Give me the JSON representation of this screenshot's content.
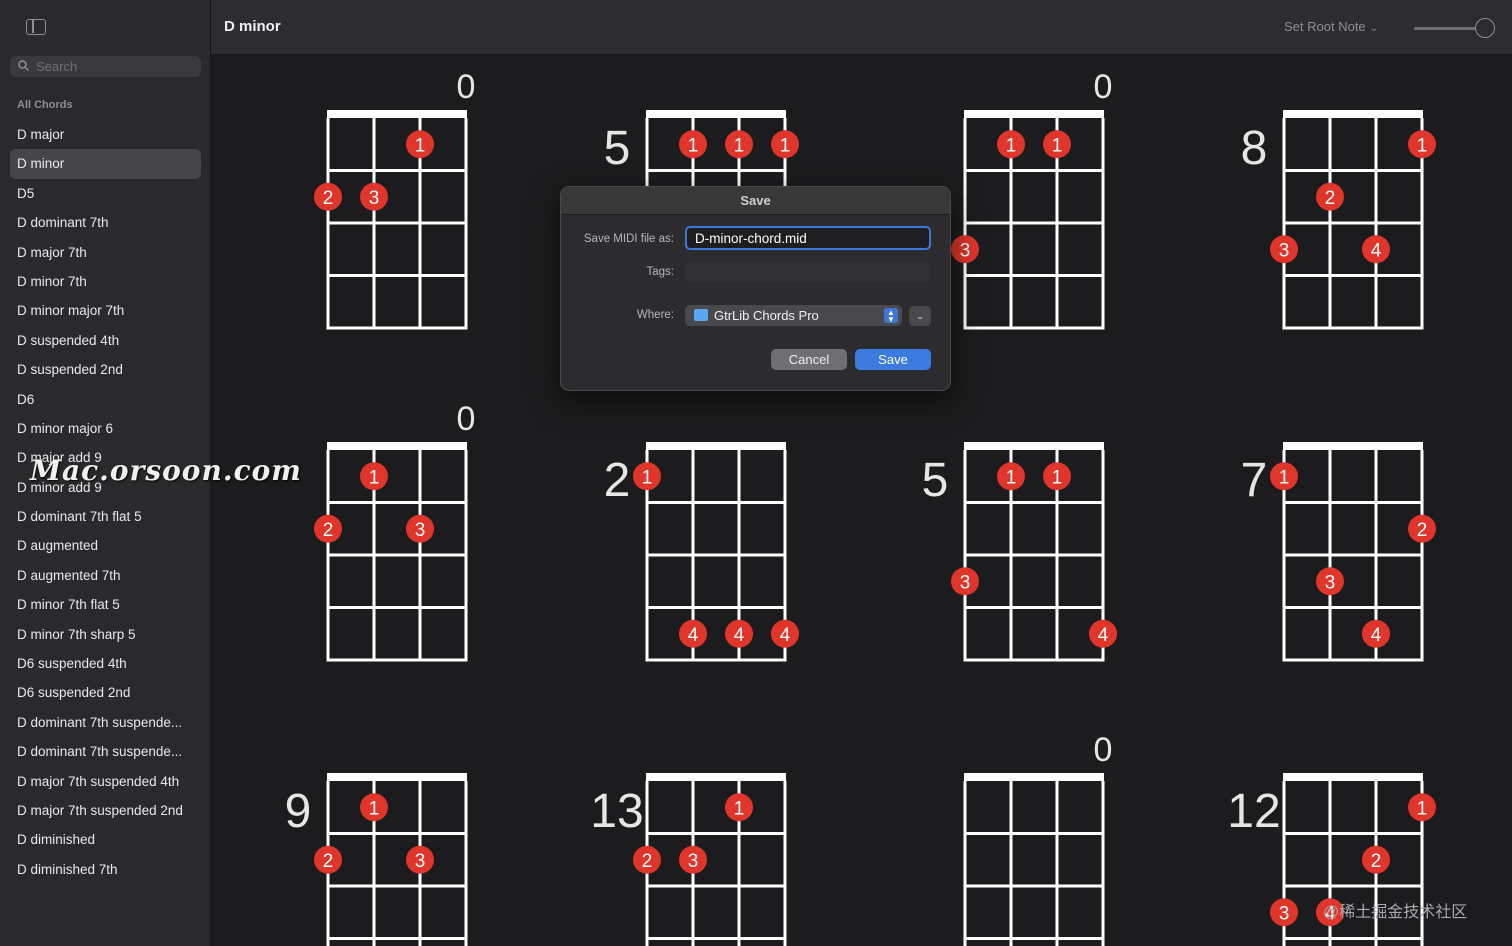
{
  "sidebar": {
    "search_placeholder": "Search",
    "section_title": "All Chords",
    "selected_index": 1,
    "items": [
      "D major",
      "D minor",
      "D5",
      "D dominant 7th",
      "D major 7th",
      "D minor 7th",
      "D minor major 7th",
      "D suspended 4th",
      "D suspended 2nd",
      "D6",
      "D minor major 6",
      "D major add 9",
      "D minor add 9",
      "D dominant 7th flat 5",
      "D augmented",
      "D augmented 7th",
      "D minor 7th flat 5",
      "D minor 7th sharp 5",
      "D6 suspended 4th",
      "D6 suspended 2nd",
      "D dominant 7th suspende...",
      "D dominant 7th suspende...",
      "D major 7th suspended 4th",
      "D major 7th suspended 2nd",
      "D diminished",
      "D diminished 7th"
    ]
  },
  "header": {
    "title": "D minor",
    "root_note_button": "Set Root Note",
    "zoom_level": 0.9
  },
  "colors": {
    "accent": "#3b7be0",
    "finger_dot": "#e0352b",
    "grid": "#ffffff",
    "background": "#1c1c1e",
    "sidebar": "#2a2a2d"
  },
  "diagrams": [
    {
      "fret": "0",
      "fret_label_top": true,
      "dots": [
        [
          3,
          1,
          "1"
        ],
        [
          1,
          2,
          "2"
        ],
        [
          2,
          2,
          "3"
        ]
      ]
    },
    {
      "fret": "5",
      "fret_label_top": false,
      "dots": [
        [
          2,
          1,
          "1"
        ],
        [
          3,
          1,
          "1"
        ],
        [
          4,
          1,
          "1"
        ]
      ]
    },
    {
      "fret": "0",
      "fret_label_top": true,
      "dots": [
        [
          2,
          1,
          "1"
        ],
        [
          3,
          1,
          "1"
        ],
        [
          1,
          3,
          "3"
        ]
      ]
    },
    {
      "fret": "8",
      "fret_label_top": false,
      "dots": [
        [
          4,
          1,
          "1"
        ],
        [
          2,
          2,
          "2"
        ],
        [
          1,
          3,
          "3"
        ],
        [
          3,
          3,
          "4"
        ]
      ]
    },
    {
      "fret": "0",
      "fret_label_top": true,
      "dots": [
        [
          2,
          1,
          "1"
        ],
        [
          1,
          2,
          "2"
        ],
        [
          3,
          2,
          "3"
        ]
      ]
    },
    {
      "fret": "2",
      "fret_label_top": false,
      "dots": [
        [
          1,
          1,
          "1"
        ],
        [
          2,
          4,
          "4"
        ],
        [
          3,
          4,
          "4"
        ],
        [
          4,
          4,
          "4"
        ]
      ]
    },
    {
      "fret": "5",
      "fret_label_top": false,
      "dots": [
        [
          2,
          1,
          "1"
        ],
        [
          3,
          1,
          "1"
        ],
        [
          1,
          3,
          "3"
        ],
        [
          4,
          4,
          "4"
        ]
      ]
    },
    {
      "fret": "7",
      "fret_label_top": false,
      "dots": [
        [
          1,
          1,
          "1"
        ],
        [
          4,
          2,
          "2"
        ],
        [
          2,
          3,
          "3"
        ],
        [
          3,
          4,
          "4"
        ]
      ]
    },
    {
      "fret": "9",
      "fret_label_top": false,
      "dots": [
        [
          2,
          1,
          "1"
        ],
        [
          1,
          2,
          "2"
        ],
        [
          3,
          2,
          "3"
        ]
      ]
    },
    {
      "fret": "13",
      "fret_label_top": false,
      "dots": [
        [
          3,
          1,
          "1"
        ],
        [
          1,
          2,
          "2"
        ],
        [
          2,
          2,
          "3"
        ]
      ]
    },
    {
      "fret": "0",
      "fret_label_top": true,
      "dots": []
    },
    {
      "fret": "12",
      "fret_label_top": false,
      "dots": [
        [
          4,
          1,
          "1"
        ],
        [
          3,
          2,
          "2"
        ],
        [
          1,
          3,
          "3"
        ],
        [
          2,
          3,
          "4"
        ]
      ]
    }
  ],
  "dialog": {
    "title": "Save",
    "filename_label": "Save MIDI file as:",
    "filename_value": "D-minor-chord.mid",
    "tags_label": "Tags:",
    "where_label": "Where:",
    "where_value": "GtrLib Chords Pro",
    "cancel_label": "Cancel",
    "save_label": "Save"
  },
  "watermarks": {
    "left": "Mac.orsoon.com",
    "right": "@稀土掘金技术社区"
  }
}
